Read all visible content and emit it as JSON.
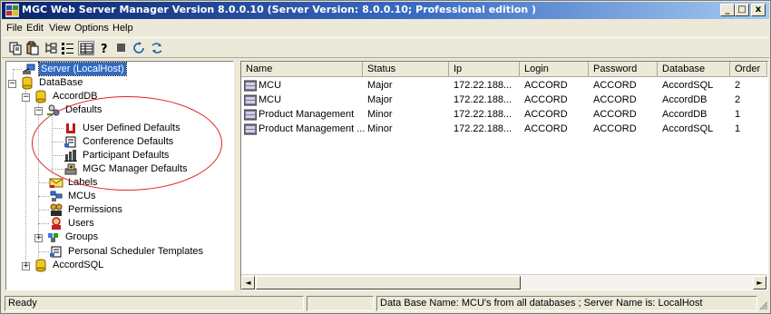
{
  "window": {
    "title": "MGC Web Server Manager Version 8.0.0.10  (Server Version: 8.0.0.10;  Professional edition )",
    "min_label": "_",
    "max_label": "□",
    "close_label": "x"
  },
  "menu": [
    "File",
    "Edit",
    "View",
    "Options",
    "Help"
  ],
  "toolbar_icons": [
    "copy-icon",
    "paste-icon",
    "tree-view-icon",
    "list-view-icon",
    "details-view-icon",
    "help-icon",
    "stop-icon",
    "refresh-icon",
    "sync-icon"
  ],
  "tree": {
    "server": "Server (LocalHost)",
    "database": "DataBase",
    "accord_db": "AccordDB",
    "defaults": "Defaults",
    "user_defined_defaults": "User Defined Defaults",
    "conference_defaults": "Conference Defaults",
    "participant_defaults": "Participant Defaults",
    "mgc_manager_defaults": "MGC Manager Defaults",
    "labels": "Labels",
    "mcus": "MCUs",
    "permissions": "Permissions",
    "users": "Users",
    "groups": "Groups",
    "personal_scheduler_templates": "Personal Scheduler Templates",
    "accord_sql": "AccordSQL",
    "expand": "+",
    "collapse": "−"
  },
  "list": {
    "columns": [
      "Name",
      "Status",
      "Ip",
      "Login",
      "Password",
      "Database",
      "Order"
    ],
    "rows": [
      [
        "MCU",
        "Major",
        "172.22.188...",
        "ACCORD",
        "ACCORD",
        "AccordSQL",
        "2"
      ],
      [
        "MCU",
        "Major",
        "172.22.188...",
        "ACCORD",
        "ACCORD",
        "AccordDB",
        "2"
      ],
      [
        "Product Management",
        "Minor",
        "172.22.188...",
        "ACCORD",
        "ACCORD",
        "AccordDB",
        "1"
      ],
      [
        "Product Management ...",
        "Minor",
        "172.22.188...",
        "ACCORD",
        "ACCORD",
        "AccordSQL",
        "1"
      ]
    ],
    "scroll_left": "◄",
    "scroll_right": "►"
  },
  "status": {
    "ready": "Ready",
    "info": "Data Base Name: MCU's from all databases ; Server Name is: LocalHost"
  }
}
